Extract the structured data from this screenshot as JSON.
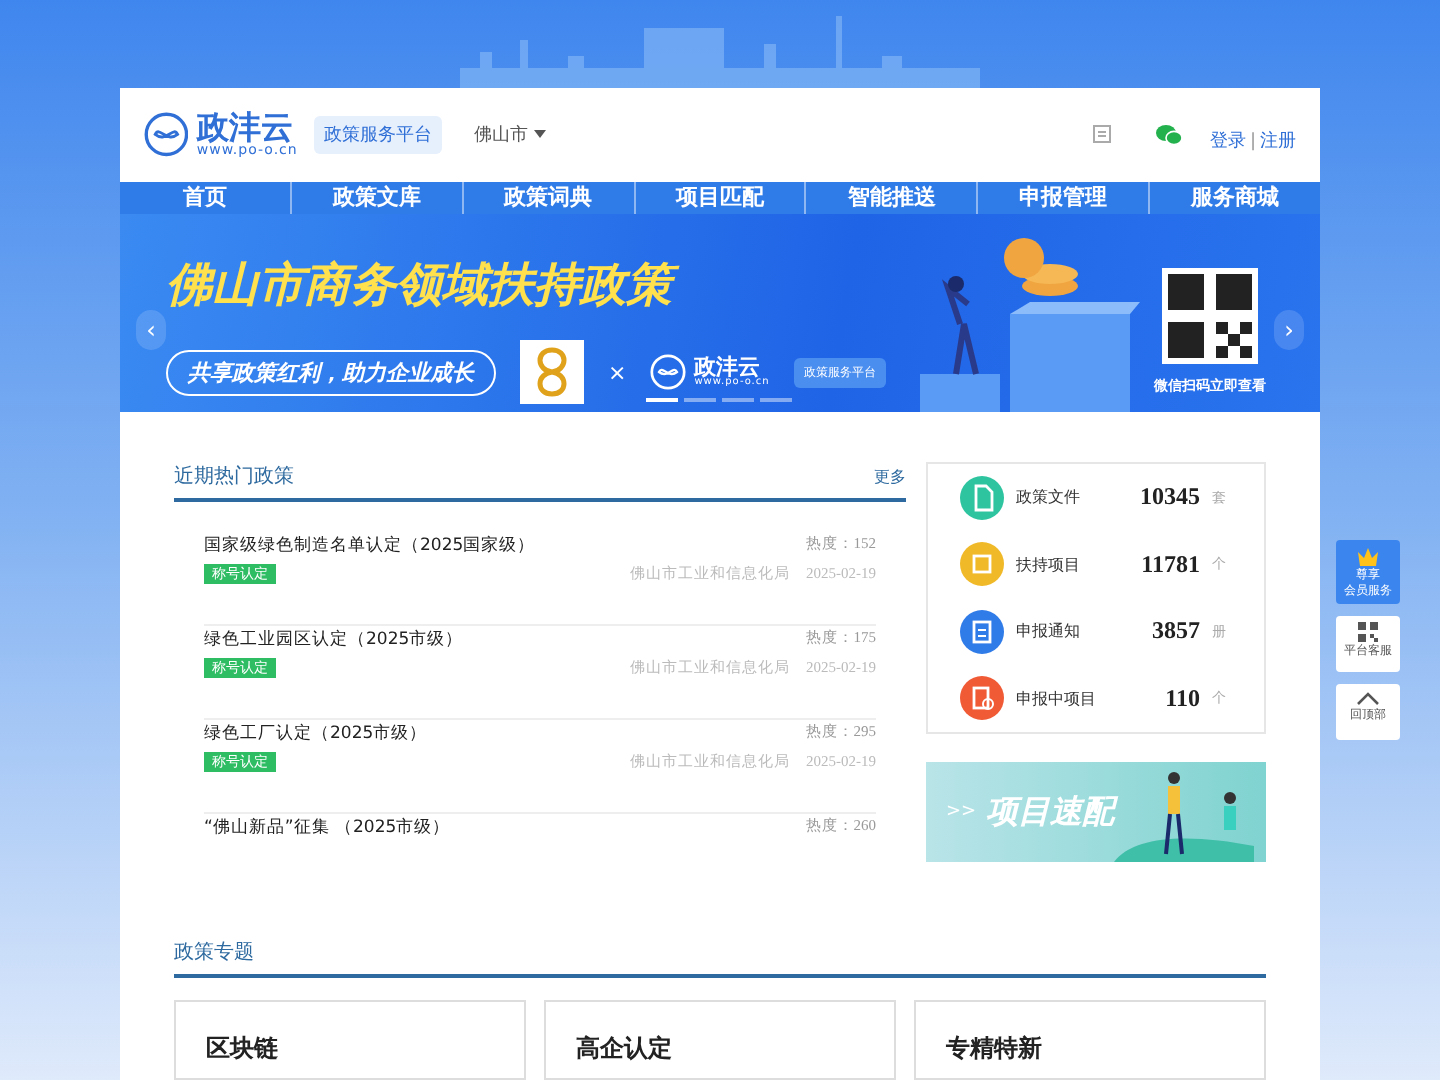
{
  "header": {
    "logo_name": "政沣云",
    "logo_url": "www.po-o.cn",
    "platform": "政策服务平台",
    "city": "佛山市",
    "login": "登录",
    "separator": "|",
    "register": "注册"
  },
  "nav": [
    {
      "label": "首页",
      "selected": false
    },
    {
      "label": "政策文库",
      "selected": false
    },
    {
      "label": "政策词典",
      "selected": false
    },
    {
      "label": "项目匹配",
      "selected": false
    },
    {
      "label": "智能推送",
      "selected": false
    },
    {
      "label": "申报管理",
      "selected": false
    },
    {
      "label": "服务商城",
      "selected": false
    }
  ],
  "banner": {
    "title": "佛山市商务领域扶持政策",
    "subtitle": "共享政策红利，助力企业成长",
    "times": "×",
    "logo_name": "政沣云",
    "logo_url": "www.po-o.cn",
    "platform": "政策服务平台",
    "qr_caption": "微信扫码立即查看",
    "prev": "‹",
    "next": "›",
    "dots": [
      {
        "selected": true
      },
      {
        "selected": false
      },
      {
        "selected": false
      },
      {
        "selected": false
      }
    ]
  },
  "hot": {
    "title": "近期热门政策",
    "more": "更多",
    "rows": [
      {
        "title": "国家级绿色制造名单认定（2025国家级）",
        "tag": "称号认定",
        "heat": "热度：152",
        "dept": "佛山市工业和信息化局",
        "date": "2025-02-19"
      },
      {
        "title": "绿色工业园区认定（2025市级）",
        "tag": "称号认定",
        "heat": "热度：175",
        "dept": "佛山市工业和信息化局",
        "date": "2025-02-19"
      },
      {
        "title": "绿色工厂认定（2025市级）",
        "tag": "称号认定",
        "heat": "热度：295",
        "dept": "佛山市工业和信息化局",
        "date": "2025-02-19"
      },
      {
        "title": "“佛山新品”征集 （2025市级）",
        "heat": "热度：260"
      }
    ]
  },
  "stats": [
    {
      "kind": "file",
      "label": "政策文件",
      "value": "10345",
      "unit": "套",
      "color": "#2ec4a0"
    },
    {
      "kind": "project",
      "label": "扶持项目",
      "value": "11781",
      "unit": "个",
      "color": "#f0b928"
    },
    {
      "kind": "notice",
      "label": "申报通知",
      "value": "3857",
      "unit": "册",
      "color": "#2f7be8"
    },
    {
      "kind": "applying",
      "label": "申报中项目",
      "value": "110",
      "unit": "个",
      "color": "#f05a35"
    }
  ],
  "promo": {
    "arrow": ">>",
    "title": "项目速配"
  },
  "topics": {
    "title": "政策专题",
    "items": [
      "区块链",
      "高企认定",
      "专精特新"
    ]
  },
  "float": [
    {
      "kind": "vip",
      "lines": [
        "尊享",
        "会员服务"
      ]
    },
    {
      "kind": "qr",
      "lines": [
        "平台客服"
      ]
    },
    {
      "kind": "top",
      "lines": [
        "回顶部"
      ]
    }
  ]
}
